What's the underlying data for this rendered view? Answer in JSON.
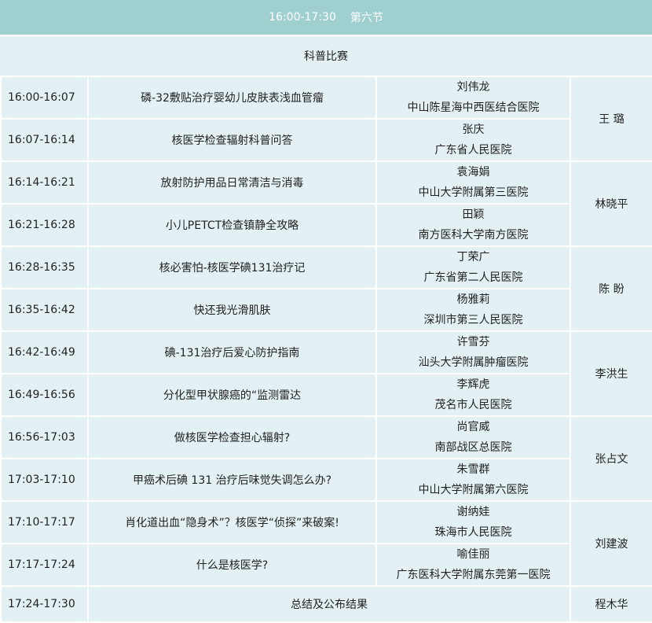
{
  "header": {
    "time": "16:00-17:30",
    "section": "第六节"
  },
  "subheader": "科普比赛",
  "rows": [
    {
      "time": "16:00-16:07",
      "topic": "磷-32敷贴治疗婴幼儿皮肤表浅血管瘤",
      "speaker": "刘伟龙",
      "hospital": "中山陈星海中西医结合医院"
    },
    {
      "time": "16:07-16:14",
      "topic": "核医学检查辐射科普问答",
      "speaker": "张庆",
      "hospital": "广东省人民医院"
    },
    {
      "time": "16:14-16:21",
      "topic": "放射防护用品日常清洁与消毒",
      "speaker": "袁海娟",
      "hospital": "中山大学附属第三医院"
    },
    {
      "time": "16:21-16:28",
      "topic": "小儿PETCT检查镇静全攻略",
      "speaker": "田颖",
      "hospital": "南方医科大学南方医院"
    },
    {
      "time": "16:28-16:35",
      "topic": "核必害怕-核医学碘131治疗记",
      "speaker": "丁荣广",
      "hospital": "广东省第二人民医院"
    },
    {
      "time": "16:35-16:42",
      "topic": "快还我光滑肌肤",
      "speaker": "杨雅莉",
      "hospital": "深圳市第三人民医院"
    },
    {
      "time": "16:42-16:49",
      "topic": "碘-131治疗后爱心防护指南",
      "speaker": "许雪芬",
      "hospital": "汕头大学附属肿瘤医院"
    },
    {
      "time": "16:49-16:56",
      "topic": "分化型甲状腺癌的“监测雷达",
      "speaker": "李辉虎",
      "hospital": "茂名市人民医院"
    },
    {
      "time": "16:56-17:03",
      "topic": "做核医学检查担心辐射?",
      "speaker": "尚官威",
      "hospital": "南部战区总医院"
    },
    {
      "time": "17:03-17:10",
      "topic": "甲癌术后碘 131 治疗后味觉失调怎么办?",
      "speaker": "朱雪群",
      "hospital": "中山大学附属第六医院"
    },
    {
      "time": "17:10-17:17",
      "topic": "肖化道出血“隐身术”？核医学“侦探”来破案!",
      "speaker": "谢纳娃",
      "hospital": "珠海市人民医院"
    },
    {
      "time": "17:17-17:24",
      "topic": "什么是核医学?",
      "speaker": "喻佳丽",
      "hospital": "广东医科大学附属东莞第一医院"
    }
  ],
  "hosts": [
    "王 璐",
    "林晓平",
    "陈 盼",
    "李洪生",
    "张占文",
    "刘建波"
  ],
  "final": {
    "time": "17:24-17:30",
    "topic": "总结及公布结果",
    "host": "程木华"
  }
}
